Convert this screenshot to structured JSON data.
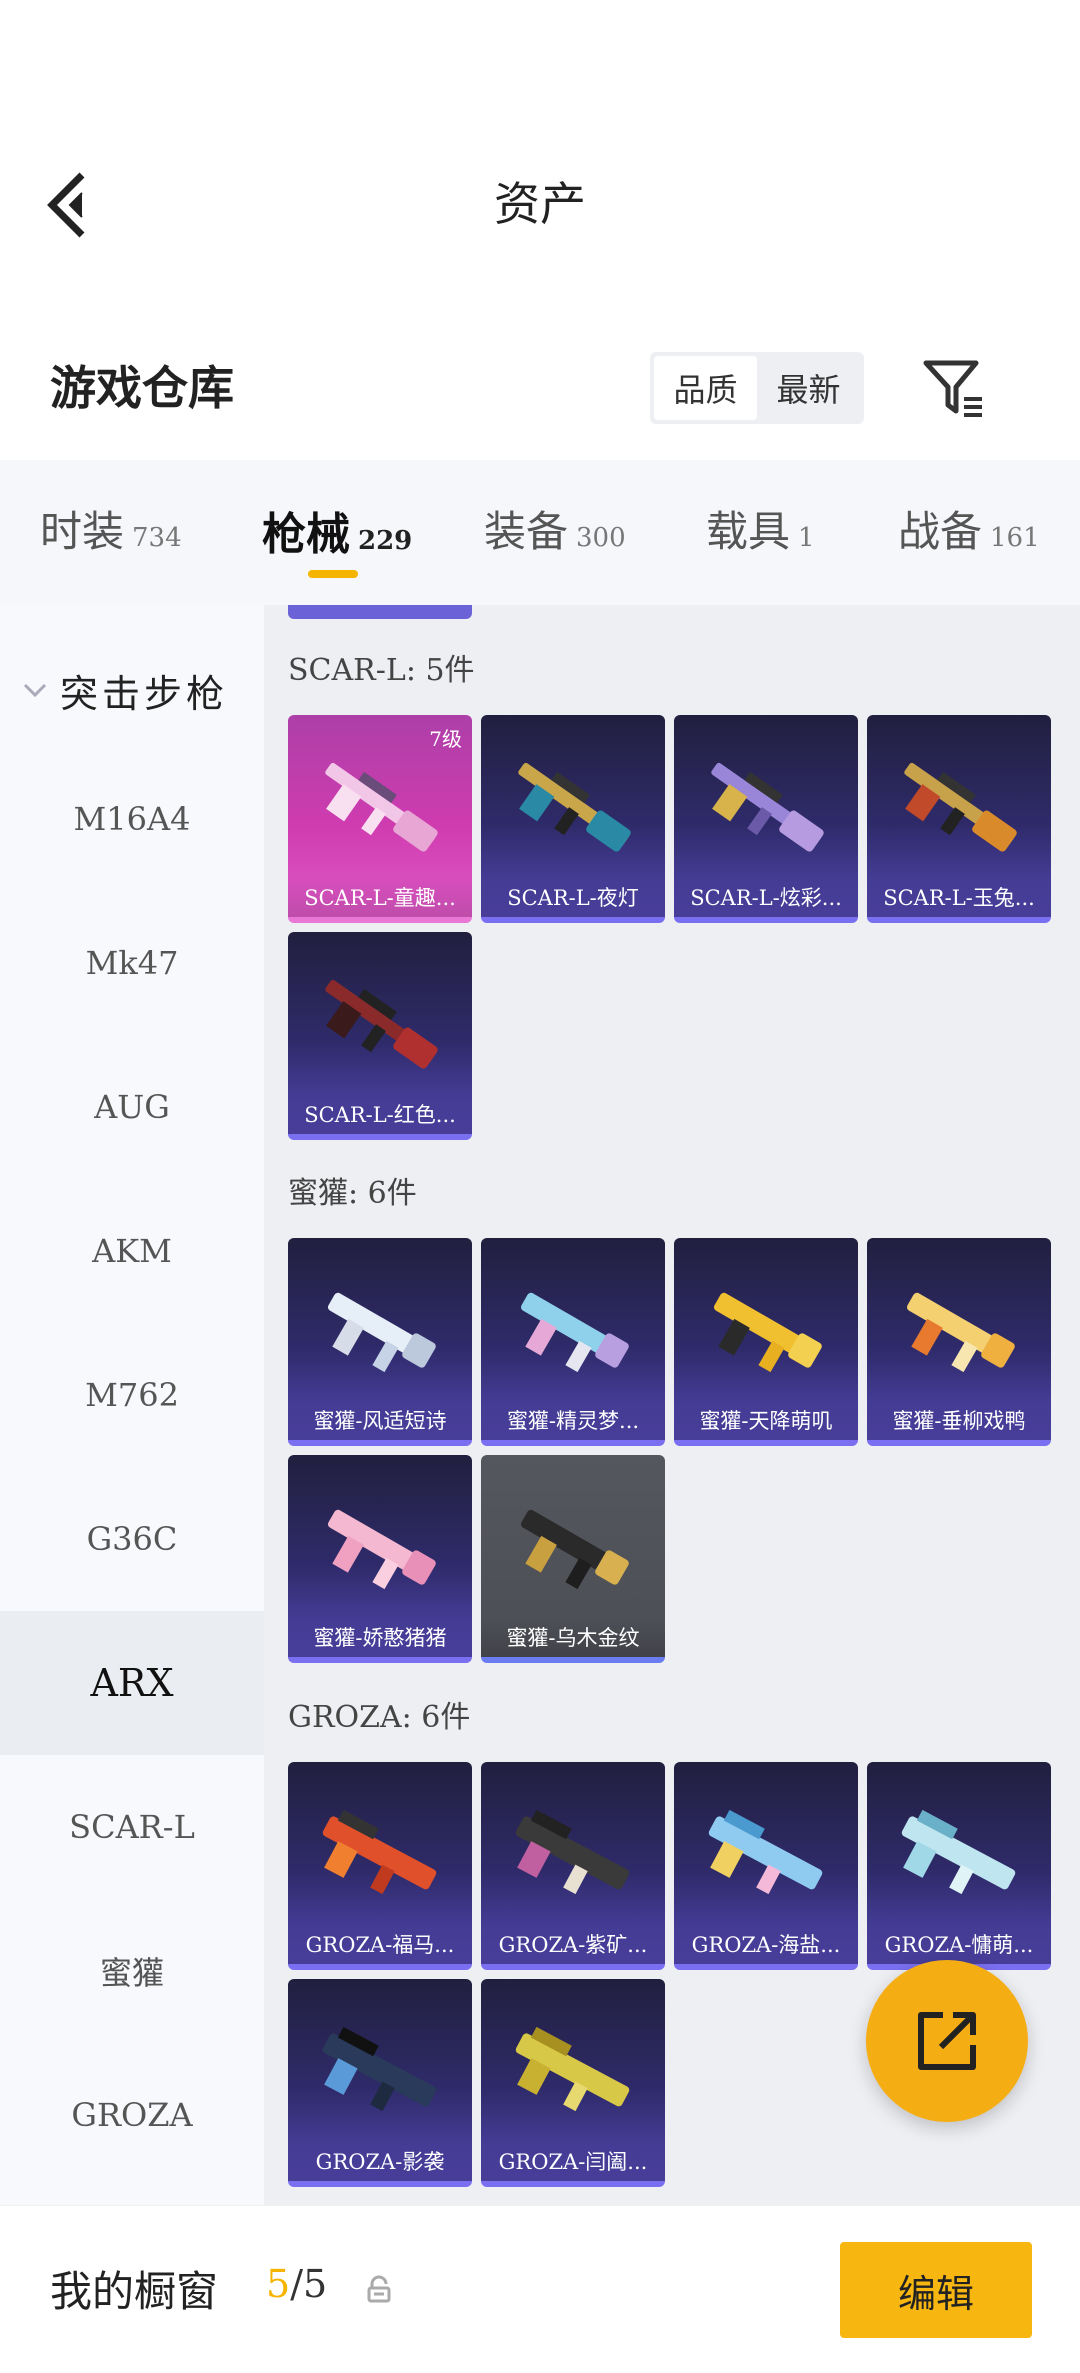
{
  "header": {
    "title": "资产"
  },
  "warehouse": {
    "title": "游戏仓库",
    "sort_options": [
      "品质",
      "最新"
    ],
    "active_sort": "品质"
  },
  "category_tabs": [
    {
      "label": "时装",
      "count": "734"
    },
    {
      "label": "枪械",
      "count": "229"
    },
    {
      "label": "装备",
      "count": "300"
    },
    {
      "label": "载具",
      "count": "1"
    },
    {
      "label": "战备",
      "count": "161"
    }
  ],
  "active_tab": "枪械",
  "sidebar": {
    "group": "突击步枪",
    "items": [
      "M16A4",
      "Mk47",
      "AUG",
      "AKM",
      "M762",
      "G36C",
      "ARX",
      "SCAR-L",
      "蜜獾",
      "GROZA"
    ],
    "active": "ARX"
  },
  "sections": [
    {
      "title": "SCAR-L: 5件",
      "items": [
        {
          "name": "SCAR-L-童趣...",
          "level": "7级"
        },
        {
          "name": "SCAR-L-夜灯"
        },
        {
          "name": "SCAR-L-炫彩..."
        },
        {
          "name": "SCAR-L-玉兔..."
        },
        {
          "name": "SCAR-L-红色..."
        }
      ]
    },
    {
      "title": "蜜獾: 6件",
      "items": [
        {
          "name": "蜜獾-风适短诗"
        },
        {
          "name": "蜜獾-精灵梦..."
        },
        {
          "name": "蜜獾-天降萌叽"
        },
        {
          "name": "蜜獾-垂柳戏鸭"
        },
        {
          "name": "蜜獾-娇憨猪猪"
        },
        {
          "name": "蜜獾-乌木金纹"
        }
      ]
    },
    {
      "title": "GROZA: 6件",
      "items": [
        {
          "name": "GROZA-福马..."
        },
        {
          "name": "GROZA-紫矿..."
        },
        {
          "name": "GROZA-海盐..."
        },
        {
          "name": "GROZA-慵萌..."
        },
        {
          "name": "GROZA-影袭"
        },
        {
          "name": "GROZA-闫阖..."
        }
      ]
    }
  ],
  "showcase": {
    "title": "我的橱窗",
    "current": "5",
    "separator": "/",
    "total": "5",
    "edit_label": "编辑"
  },
  "colors": {
    "accent": "#f5b400",
    "card_bg": "#2f2b6b",
    "card_border": "#7a6ff0"
  }
}
